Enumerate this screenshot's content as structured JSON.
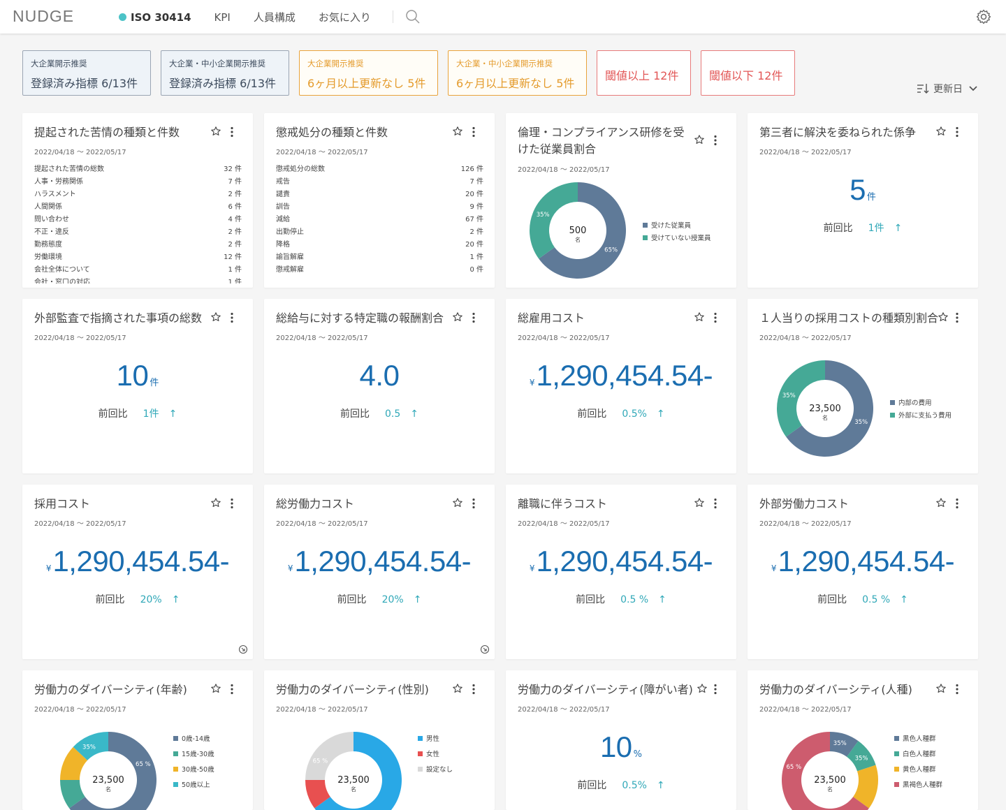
{
  "app": {
    "logo": "NUDGE",
    "nav": [
      "ISO 30414",
      "KPI",
      "人員構成",
      "お気に入り"
    ]
  },
  "chips": [
    {
      "small": "大企業開示推奨",
      "big": "登録済み指標 6/13件"
    },
    {
      "small": "大企業・中小企業開示推奨",
      "big": "登録済み指標 6/13件"
    },
    {
      "small": "大企業開示推奨",
      "big": "6ヶ月以上更新なし 5件"
    },
    {
      "small": "大企業・中小企業開示推奨",
      "big": "6ヶ月以上更新なし 5件"
    },
    {
      "big": "閾値以上 12件"
    },
    {
      "big": "閾値以下 12件"
    }
  ],
  "sort": {
    "label": "更新日"
  },
  "date": "2022/04/18 〜 2022/05/17",
  "cmp_label": "前回比",
  "cards": [
    {
      "title": "提起された苦情の種類と件数",
      "rows": [
        [
          "提起された苦情の総数",
          "32 件"
        ],
        [
          "人事・労務関係",
          "7 件"
        ],
        [
          "ハラスメント",
          "2 件"
        ],
        [
          "人間関係",
          "6 件"
        ],
        [
          "問い合わせ",
          "4 件"
        ],
        [
          "不正・違反",
          "2 件"
        ],
        [
          "勤務態度",
          "2 件"
        ],
        [
          "労働環境",
          "12 件"
        ],
        [
          "会社全体について",
          "1 件"
        ],
        [
          "会社・窓口の対応",
          "1 件"
        ]
      ]
    },
    {
      "title": "懲戒処分の種類と件数",
      "rows": [
        [
          "懲戒処分の総数",
          "126 件"
        ],
        [
          "戒告",
          "7 件"
        ],
        [
          "譴責",
          "20 件"
        ],
        [
          "訓告",
          "9 件"
        ],
        [
          "減給",
          "67 件"
        ],
        [
          "出勤停止",
          "2 件"
        ],
        [
          "降格",
          "20 件"
        ],
        [
          "諭旨解雇",
          "1 件"
        ],
        [
          "懲戒解雇",
          "0 件"
        ]
      ]
    },
    {
      "title": "倫理・コンプライアンス研修を受けた従業員割合",
      "center": "500",
      "center_unit": "名",
      "legend": [
        "受けた従業員",
        "受けていない授業員"
      ],
      "values": [
        65,
        35
      ],
      "labels": [
        "65%",
        "35%"
      ]
    },
    {
      "title": "第三者に解決を委ねられた係争",
      "value": "5",
      "unit": "件",
      "diff": "1件"
    },
    {
      "title": "外部監査で指摘された事項の総数",
      "value": "10",
      "unit": "件",
      "diff": "1件"
    },
    {
      "title": "総給与に対する特定職の報酬割合",
      "value": "4.0",
      "diff": "0.5"
    },
    {
      "title": "総雇用コスト",
      "yen": "¥",
      "value": "1,290,454.54-",
      "diff": "0.5%"
    },
    {
      "title": "１人当りの採用コストの種類別割合",
      "center": "23,500",
      "center_unit": "名",
      "legend": [
        "内部の費用",
        "外部に支払う費用"
      ],
      "values": [
        65,
        35
      ],
      "labels": [
        "35%",
        "35%"
      ]
    },
    {
      "title": "採用コスト",
      "yen": "¥",
      "value": "1,290,454.54-",
      "diff": "20%"
    },
    {
      "title": "総労働力コスト",
      "yen": "¥",
      "value": "1,290,454.54-",
      "diff": "20%"
    },
    {
      "title": "離職に伴うコスト",
      "yen": "¥",
      "value": "1,290,454.54-",
      "diff": "0.5 %"
    },
    {
      "title": "外部労働力コスト",
      "yen": "¥",
      "value": "1,290,454.54-",
      "diff": "0.5 %"
    },
    {
      "title": "労働力のダイバーシティ(年齢)",
      "center": "23,500",
      "center_unit": "名",
      "legend": [
        "0歳-14歳",
        "15歳-30歳",
        "30歳-50歳",
        "50歳以上"
      ],
      "values": [
        65,
        10,
        12,
        13
      ],
      "labels": [
        "65 %",
        "35%"
      ]
    },
    {
      "title": "労働力のダイバーシティ(性別)",
      "center": "23,500",
      "center_unit": "名",
      "legend": [
        "男性",
        "女性",
        "設定なし"
      ],
      "values": [
        65,
        10,
        25
      ],
      "labels": [
        "65 %"
      ]
    },
    {
      "title": "労働力のダイバーシティ(障がい者)",
      "value": "10",
      "unit": "%",
      "diff": "0.5%"
    },
    {
      "title": "労働力のダイバーシティ(人種)",
      "center": "23,500",
      "center_unit": "名",
      "legend": [
        "黒色人種群",
        "白色人種群",
        "黄色人種群",
        "黒褐色人種群"
      ],
      "values": [
        10,
        10,
        15,
        65
      ],
      "labels": [
        "35%",
        "35%",
        "65 %"
      ]
    }
  ],
  "colors": {
    "slate": "#5f7a98",
    "teal": "#45a996",
    "amber": "#f0b429",
    "cyan": "#3ab8c8",
    "blue": "#29a8e6",
    "red": "#e85050",
    "gray": "#d9d9d9",
    "crimson": "#cd5c6e",
    "number": "#1a6db0",
    "diff": "#30a8b8"
  }
}
